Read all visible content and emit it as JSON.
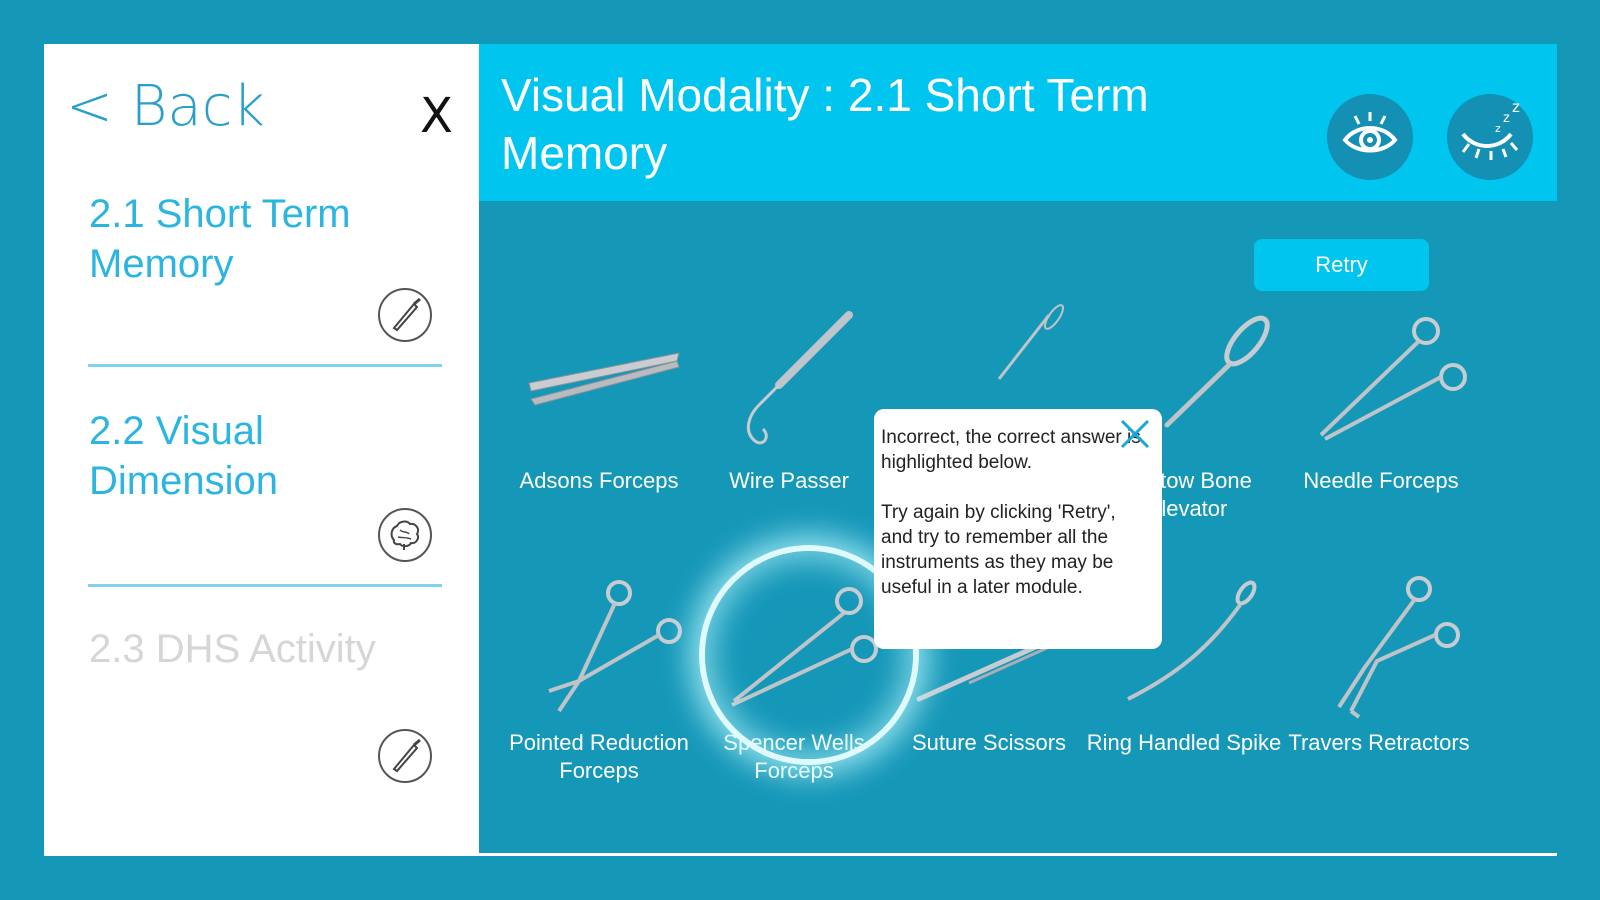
{
  "sidebar": {
    "back_label": "< Back",
    "close_label": "X",
    "items": [
      {
        "label": "2.1 Short Term Memory",
        "icon": "scalpel-icon",
        "state": "active"
      },
      {
        "label": "2.2 Visual Dimension",
        "icon": "brain-icon",
        "state": "active"
      },
      {
        "label": "2.3 DHS Activity",
        "icon": "scalpel-icon",
        "state": "disabled"
      }
    ]
  },
  "header": {
    "title": "Visual Modality : 2.1 Short Term Memory",
    "buttons": [
      {
        "icon": "eye-open-icon"
      },
      {
        "icon": "eye-closed-sleep-icon"
      }
    ]
  },
  "main": {
    "retry_label": "Retry",
    "instruments": [
      {
        "label": "Adsons Forceps"
      },
      {
        "label": "Wire Passer"
      },
      {
        "label": ""
      },
      {
        "label": "Bristow Bone Elevator"
      },
      {
        "label": "Needle Forceps"
      },
      {
        "label": "Pointed Reduction Forceps"
      },
      {
        "label": "Spencer Wells Forceps",
        "highlighted": true
      },
      {
        "label": "Suture Scissors"
      },
      {
        "label": "Ring Handled Spike"
      },
      {
        "label": "Travers Retractors"
      }
    ],
    "popup": {
      "message": "Incorrect, the correct answer is highlighted below.\n\nTry again by clicking 'Retry', and try to remember all the instruments as they may be useful in a later module."
    }
  },
  "colors": {
    "background": "#1597b8",
    "header": "#00c5ef",
    "sidebar_link": "#2bb5e0",
    "disabled": "#d6d6d6"
  }
}
